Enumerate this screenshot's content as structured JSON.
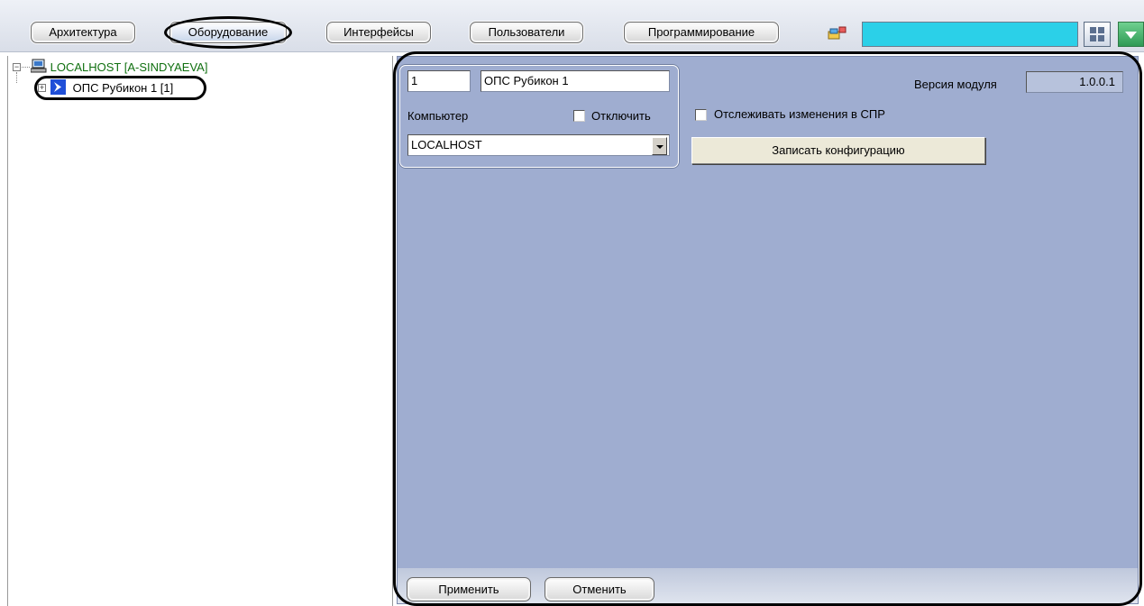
{
  "tabs": [
    {
      "label": "Архитектура"
    },
    {
      "label": "Оборудование"
    },
    {
      "label": "Интерфейсы"
    },
    {
      "label": "Пользователи"
    },
    {
      "label": "Программирование"
    }
  ],
  "tree": {
    "root": {
      "label": "LOCALHOST [A-SINDYAEVA]",
      "icon": "computer-icon",
      "color": "#107010"
    },
    "child": {
      "label": "ОПС Рубикон 1 [1]",
      "icon": "rubikon-icon",
      "color": "#1f4fd8"
    }
  },
  "object": {
    "id_value": "1",
    "name_value": "ОПС Рубикон 1",
    "computer_label": "Компьютер",
    "disable_label": "Отключить",
    "computer_value": "LOCALHOST"
  },
  "module": {
    "version_label": "Версия модуля",
    "version_value": "1.0.0.1"
  },
  "options": {
    "track_label": "Отслеживать изменения в СПР",
    "write_config_label": "Записать конфигурацию"
  },
  "footer": {
    "apply_label": "Применить",
    "cancel_label": "Отменить"
  },
  "colors": {
    "panel_bg": "#9fadd0",
    "search_field": "#2bd0e8",
    "tree_root_text": "#107010"
  }
}
